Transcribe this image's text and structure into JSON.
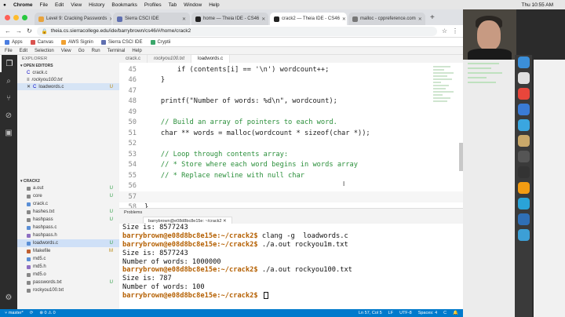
{
  "mac_menu": {
    "apple": "",
    "app": "Chrome",
    "items": [
      "File",
      "Edit",
      "View",
      "History",
      "Bookmarks",
      "Profiles",
      "Tab",
      "Window",
      "Help"
    ],
    "clock": "Thu 10:55 AM"
  },
  "browser": {
    "tabs": [
      {
        "title": "Level 9: Cracking Passwords",
        "color": "#e8a33c",
        "active": false
      },
      {
        "title": "Sierra CSCI IDE",
        "color": "#5f6fb0",
        "active": false
      },
      {
        "title": "home — Theia IDE - CS46",
        "color": "#222222",
        "active": false
      },
      {
        "title": "crack2 — Theia IDE - CS46",
        "color": "#222222",
        "active": true
      },
      {
        "title": "malloc - cppreference.com",
        "color": "#777777",
        "active": false
      }
    ],
    "new_tab": "+",
    "url": "theia.cs.sierracollege.edu/ide/barrybrown/cs46/#/home/crack2",
    "bookmarks": [
      {
        "label": "Apps",
        "color": "#4a7de0"
      },
      {
        "label": "Canvas",
        "color": "#d9534f"
      },
      {
        "label": "AWS Signin",
        "color": "#f0a030"
      },
      {
        "label": "Sierra CSCI IDE",
        "color": "#5f6fb0"
      },
      {
        "label": "Cryptii",
        "color": "#3aa66a"
      }
    ]
  },
  "theia": {
    "menu": [
      "File",
      "Edit",
      "Selection",
      "View",
      "Go",
      "Run",
      "Terminal",
      "Help"
    ],
    "explorer_title": "EXPLORER",
    "open_editors_header": "OPEN EDITORS",
    "open_editors": [
      {
        "name": "crack.c",
        "status": ""
      },
      {
        "name": "rockyou100.txt",
        "status": ""
      },
      {
        "name": "loadwords.c",
        "status": "U",
        "active": true
      }
    ],
    "folder_header": "CRACK2",
    "files": [
      {
        "name": "a.out",
        "status": "U",
        "color": "#888888"
      },
      {
        "name": "core",
        "status": "U",
        "color": "#888888"
      },
      {
        "name": "crack.c",
        "status": "",
        "color": "#5a8fd6"
      },
      {
        "name": "hashes.txt",
        "status": "U",
        "color": "#888888"
      },
      {
        "name": "hashpass",
        "status": "U",
        "color": "#888888"
      },
      {
        "name": "hashpass.c",
        "status": "",
        "color": "#5a8fd6"
      },
      {
        "name": "hashpass.h",
        "status": "",
        "color": "#8e6fc2"
      },
      {
        "name": "loadwords.c",
        "status": "U",
        "color": "#5a8fd6",
        "selected": true
      },
      {
        "name": "Makefile",
        "status": "M",
        "color": "#c06030"
      },
      {
        "name": "md5.c",
        "status": "",
        "color": "#5a8fd6"
      },
      {
        "name": "md5.h",
        "status": "",
        "color": "#8e6fc2"
      },
      {
        "name": "md5.o",
        "status": "",
        "color": "#888888"
      },
      {
        "name": "passwords.txt",
        "status": "U",
        "color": "#888888"
      },
      {
        "name": "rockyou100.txt",
        "status": "",
        "color": "#888888"
      }
    ],
    "editor_tabs": [
      {
        "label": "crack.c",
        "italic": false,
        "active": false
      },
      {
        "label": "rockyou100.txt",
        "italic": true,
        "active": false
      },
      {
        "label": "loadwords.c",
        "italic": false,
        "active": true
      }
    ],
    "code_lines": [
      {
        "n": "45",
        "text": "        if (contents[i] == '\\n') wordcount++;",
        "cls": "txt"
      },
      {
        "n": "46",
        "text": "    }",
        "cls": "txt"
      },
      {
        "n": "47",
        "text": "",
        "cls": "txt"
      },
      {
        "n": "48",
        "text": "    printf(\"Number of words: %d\\n\", wordcount);",
        "cls": "txt"
      },
      {
        "n": "49",
        "text": "",
        "cls": "txt"
      },
      {
        "n": "50",
        "text": "    // Build an array of pointers to each word.",
        "cls": "cmt"
      },
      {
        "n": "51",
        "text": "    char ** words = malloc(wordcount * sizeof(char *));",
        "cls": "txt"
      },
      {
        "n": "52",
        "text": "",
        "cls": "txt"
      },
      {
        "n": "53",
        "text": "    // Loop through contents array:",
        "cls": "cmt"
      },
      {
        "n": "54",
        "text": "    // * Store where each word begins in words array",
        "cls": "cmt"
      },
      {
        "n": "55",
        "text": "    // * Replace newline with null char",
        "cls": "cmt"
      },
      {
        "n": "56",
        "text": "",
        "cls": "txt"
      },
      {
        "n": "57",
        "text": "",
        "cls": "txt",
        "current": true
      },
      {
        "n": "58",
        "text": "}",
        "cls": "txt"
      }
    ],
    "panel_problems": "Problems",
    "panel_terminal": "barrybrown@e08d8bc8e15e: ~/crack2",
    "terminal_lines": [
      {
        "prompt": "",
        "text": "Size is: 8577243"
      },
      {
        "prompt": "barrybrown@e08d8bc8e15e:~/crack2$",
        "text": " clang -g  loadwords.c"
      },
      {
        "prompt": "barrybrown@e08d8bc8e15e:~/crack2$",
        "text": " ./a.out rockyou1m.txt"
      },
      {
        "prompt": "",
        "text": "Size is: 8577243"
      },
      {
        "prompt": "",
        "text": "Number of words: 1000000"
      },
      {
        "prompt": "barrybrown@e08d8bc8e15e:~/crack2$",
        "text": " ./a.out rockyou100.txt"
      },
      {
        "prompt": "",
        "text": "Size is: 787"
      },
      {
        "prompt": "",
        "text": "Number of words: 100"
      },
      {
        "prompt": "barrybrown@e08d8bc8e15e:~/crack2$",
        "text": " ",
        "cursor": true
      }
    ],
    "status": {
      "branch": "master*",
      "sync": "⟳",
      "errors": "⊗ 0 ⚠ 0",
      "position": "Ln 57, Col 5",
      "eol": "LF",
      "encoding": "UTF-8",
      "spaces": "Spaces: 4",
      "language": "C"
    }
  },
  "dock_colors": [
    "#3b8fd9",
    "#e0e0e0",
    "#e8463b",
    "#3a7bd5",
    "#3aa6e0",
    "#c9a86a",
    "#555555",
    "#333333",
    "#f39c12",
    "#2aa3d8",
    "#2f6fb5",
    "#3c9fd6"
  ]
}
